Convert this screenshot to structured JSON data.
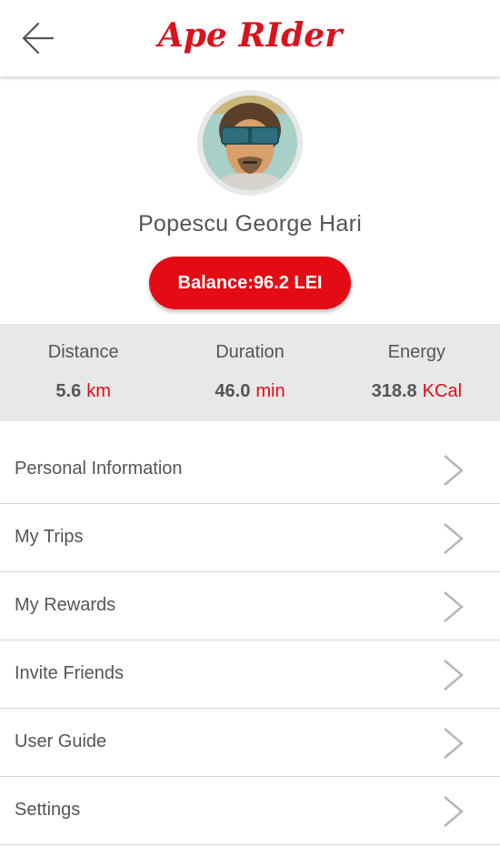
{
  "header": {
    "title": "Ape RIder",
    "back_icon": "arrow-left-icon"
  },
  "profile": {
    "name": "Popescu George Hari",
    "balance_label": "Balance:96.2 LEI"
  },
  "stats": [
    {
      "label": "Distance",
      "value": "5.6",
      "unit": "km"
    },
    {
      "label": "Duration",
      "value": "46.0",
      "unit": "min"
    },
    {
      "label": "Energy",
      "value": "318.8",
      "unit": "KCal"
    }
  ],
  "menu": {
    "items": [
      {
        "label": "Personal Information"
      },
      {
        "label": "My Trips"
      },
      {
        "label": "My Rewards"
      },
      {
        "label": "Invite Friends"
      },
      {
        "label": "User Guide"
      },
      {
        "label": "Settings"
      }
    ]
  },
  "colors": {
    "accent": "#e30b14",
    "text": "#555555",
    "stats_bg": "#e8e8ea",
    "divider": "#d6d6d6"
  }
}
